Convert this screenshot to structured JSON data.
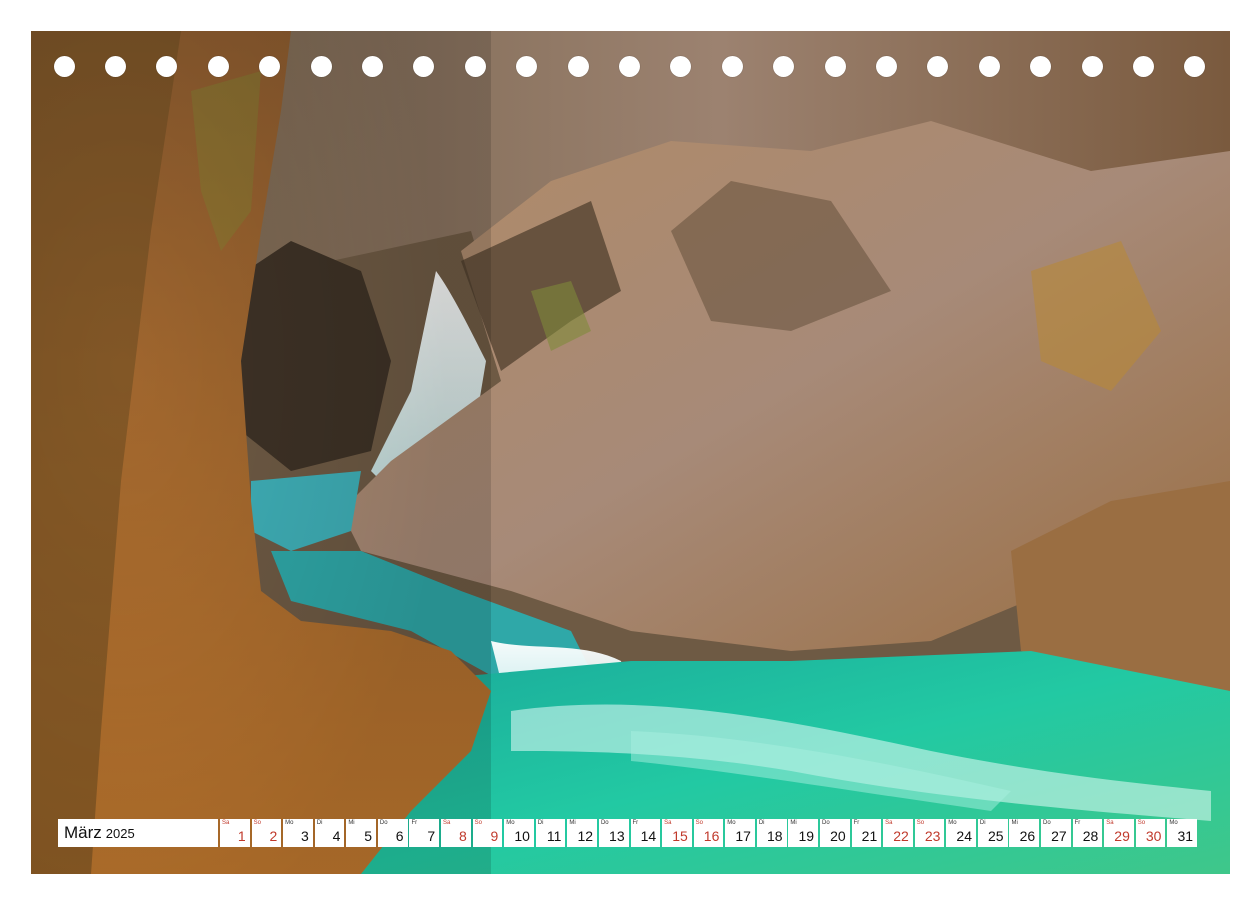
{
  "calendar": {
    "month": "März",
    "year": "2025",
    "days": [
      {
        "dow": "Sa",
        "num": "1",
        "weekend": true
      },
      {
        "dow": "So",
        "num": "2",
        "weekend": true
      },
      {
        "dow": "Mo",
        "num": "3",
        "weekend": false
      },
      {
        "dow": "Di",
        "num": "4",
        "weekend": false
      },
      {
        "dow": "Mi",
        "num": "5",
        "weekend": false
      },
      {
        "dow": "Do",
        "num": "6",
        "weekend": false
      },
      {
        "dow": "Fr",
        "num": "7",
        "weekend": false
      },
      {
        "dow": "Sa",
        "num": "8",
        "weekend": true
      },
      {
        "dow": "So",
        "num": "9",
        "weekend": true
      },
      {
        "dow": "Mo",
        "num": "10",
        "weekend": false
      },
      {
        "dow": "Di",
        "num": "11",
        "weekend": false
      },
      {
        "dow": "Mi",
        "num": "12",
        "weekend": false
      },
      {
        "dow": "Do",
        "num": "13",
        "weekend": false
      },
      {
        "dow": "Fr",
        "num": "14",
        "weekend": false
      },
      {
        "dow": "Sa",
        "num": "15",
        "weekend": true
      },
      {
        "dow": "So",
        "num": "16",
        "weekend": true
      },
      {
        "dow": "Mo",
        "num": "17",
        "weekend": false
      },
      {
        "dow": "Di",
        "num": "18",
        "weekend": false
      },
      {
        "dow": "Mi",
        "num": "19",
        "weekend": false
      },
      {
        "dow": "Do",
        "num": "20",
        "weekend": false
      },
      {
        "dow": "Fr",
        "num": "21",
        "weekend": false
      },
      {
        "dow": "Sa",
        "num": "22",
        "weekend": true
      },
      {
        "dow": "So",
        "num": "23",
        "weekend": true
      },
      {
        "dow": "Mo",
        "num": "24",
        "weekend": false
      },
      {
        "dow": "Di",
        "num": "25",
        "weekend": false
      },
      {
        "dow": "Mi",
        "num": "26",
        "weekend": false
      },
      {
        "dow": "Do",
        "num": "27",
        "weekend": false
      },
      {
        "dow": "Fr",
        "num": "28",
        "weekend": false
      },
      {
        "dow": "Sa",
        "num": "29",
        "weekend": true
      },
      {
        "dow": "So",
        "num": "30",
        "weekend": true
      },
      {
        "dow": "Mo",
        "num": "31",
        "weekend": false
      }
    ]
  },
  "colors": {
    "weekend": "#c0392b",
    "rock": "#8a6a4a",
    "water": "#1fbf9a"
  }
}
